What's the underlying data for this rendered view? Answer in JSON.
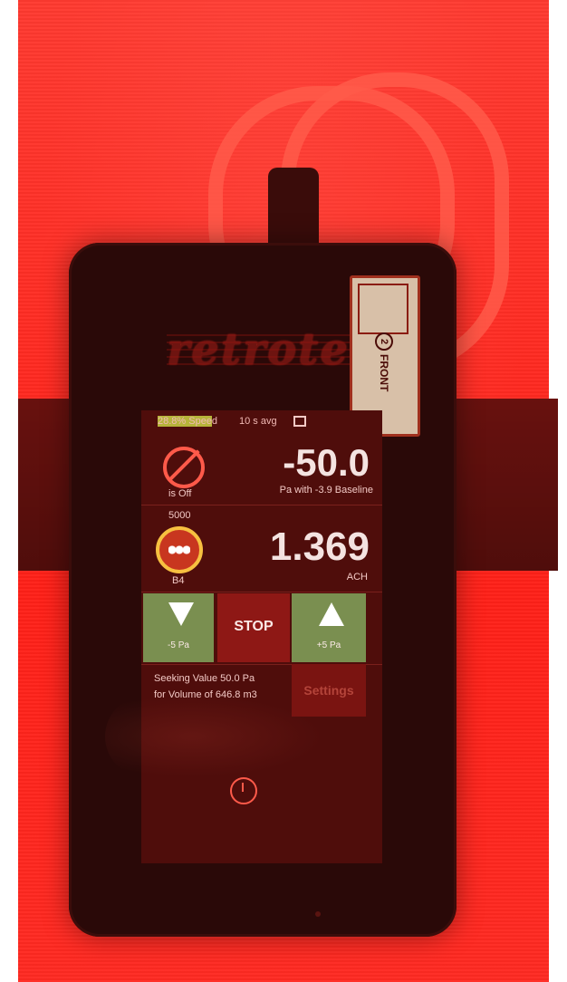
{
  "brand": {
    "name": "retrotec"
  },
  "sticker": {
    "number": "2",
    "text": "FRONT"
  },
  "status": {
    "speed": "28.8% Speed",
    "speed_fraction": 0.288,
    "avg": "10 s avg",
    "network_icon": "network-icon"
  },
  "pressure": {
    "fan_status": "is Off",
    "value": "-50.0",
    "label": "Pa with -3.9 Baseline"
  },
  "flow": {
    "ring_label": "5000",
    "ring_name": "B4",
    "value": "1.369",
    "unit": "ACH"
  },
  "controls": {
    "down_label": "-5 Pa",
    "stop_label": "STOP",
    "up_label": "+5 Pa"
  },
  "seek": {
    "line1": "Seeking Value  50.0 Pa",
    "line2": "for Volume of 646.8 m3",
    "settings_label": "Settings"
  },
  "device": {
    "power_icon": "power-icon"
  },
  "colors": {
    "background": "#ff2a22",
    "screen": "#4f0d0b",
    "button_green": "#7a8f50",
    "stop_red": "#8e1815"
  }
}
